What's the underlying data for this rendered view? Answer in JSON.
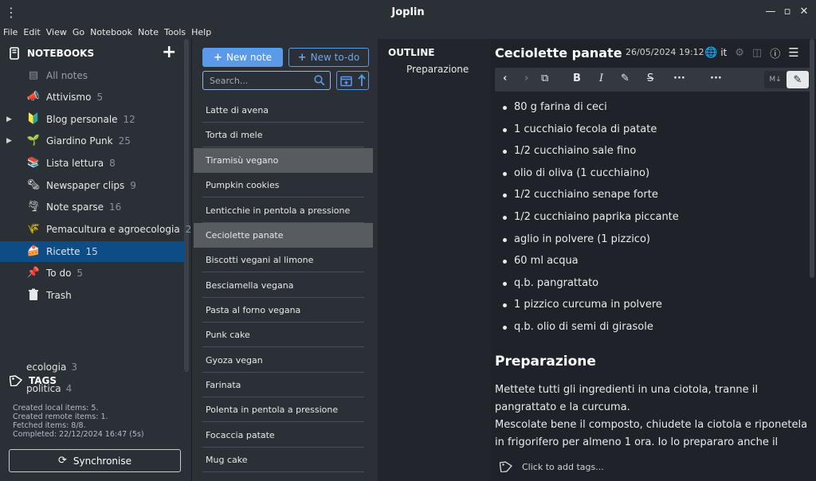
{
  "app": {
    "title": "Joplin"
  },
  "menu": [
    "File",
    "Edit",
    "View",
    "Go",
    "Notebook",
    "Note",
    "Tools",
    "Help"
  ],
  "sidebar": {
    "notebooks_label": "NOTEBOOKS",
    "all_notes": "All notes",
    "notebooks": [
      {
        "name": "Attivismo",
        "count": "5",
        "icon": "megaphone-icon",
        "glyph": "📣",
        "expand": false
      },
      {
        "name": "Blog personale",
        "count": "12",
        "icon": "beginner-icon",
        "glyph": "🔰",
        "expand": true
      },
      {
        "name": "Giardino Punk",
        "count": "25",
        "icon": "seedling-icon",
        "glyph": "🌱",
        "expand": true
      },
      {
        "name": "Lista lettura",
        "count": "8",
        "icon": "books-icon",
        "glyph": "📚",
        "expand": false
      },
      {
        "name": "Newspaper clips",
        "count": "9",
        "icon": "newspaper-icon",
        "glyph": "🗞",
        "expand": false
      },
      {
        "name": "Note sparse",
        "count": "16",
        "icon": "tornado-icon",
        "glyph": "🌪",
        "expand": false
      },
      {
        "name": "Pemacultura e agroecologia",
        "count": "2",
        "icon": "wheat-icon",
        "glyph": "🌾",
        "expand": false
      },
      {
        "name": "Ricette",
        "count": "15",
        "icon": "cake-icon",
        "glyph": "🍰",
        "expand": false,
        "selected": true
      },
      {
        "name": "To do",
        "count": "5",
        "icon": "pushpin-icon",
        "glyph": "📌",
        "expand": false
      }
    ],
    "trash": "Trash",
    "tags_label": "TAGS",
    "tags": [
      {
        "name": "ecologia",
        "count": "3"
      },
      {
        "name": "politica",
        "count": "4"
      }
    ],
    "sync_log": [
      "Created local items: 5.",
      "Created remote items: 1.",
      "Fetched items: 8/8.",
      "Completed: 22/12/2024 16:47 (5s)"
    ],
    "sync_button": "Synchronise"
  },
  "notelist": {
    "new_note": "New note",
    "new_todo": "New to-do",
    "search_placeholder": "Search...",
    "notes": [
      {
        "title": "Latte di avena"
      },
      {
        "title": "Torta di mele"
      },
      {
        "title": "Tiramisù vegano",
        "selected": true
      },
      {
        "title": "Pumpkin cookies"
      },
      {
        "title": "Lenticchie in pentola a pressione"
      },
      {
        "title": "Ceciolette panate",
        "selected": true
      },
      {
        "title": "Biscotti vegani al limone"
      },
      {
        "title": "Besciamella vegana"
      },
      {
        "title": "Pasta al forno vegana"
      },
      {
        "title": "Punk cake"
      },
      {
        "title": "Gyoza vegan"
      },
      {
        "title": "Farinata"
      },
      {
        "title": "Polenta in pentola a pressione"
      },
      {
        "title": "Focaccia patate"
      },
      {
        "title": "Mug cake"
      }
    ]
  },
  "editor": {
    "outline_label": "OUTLINE",
    "outline_items": [
      "Preparazione"
    ],
    "title": "Ceciolette panate",
    "date": "26/05/2024 19:12",
    "language": "it",
    "ingredients": [
      "80 g farina di ceci",
      "1 cucchiaio fecola di patate",
      "1/2 cucchiaino sale fino",
      "olio di oliva (1 cucchiaino)",
      "1/2 cucchiaino senape forte",
      "1/2 cucchiaino paprika piccante",
      "aglio in polvere (1 pizzico)",
      "60 ml acqua",
      "q.b. pangrattato",
      "1 pizzico curcuma in polvere",
      "q.b. olio di semi di girasole"
    ],
    "section_heading": "Preparazione",
    "paragraph_1": "Mettete tutti gli ingredienti in una ciotola, tranne il pangrattato e la curcuma.",
    "paragraph_2": "Mescolate bene il composto, chiudete la ciotola e riponetela in frigorifero per almeno 1 ora. Io lo prepararo anche il giorno",
    "tags_placeholder": "Click to add tags..."
  },
  "colors": {
    "selected_notebook": "#0d4c84",
    "accent": "#5b9ae8",
    "selected_note": "#585b60"
  }
}
